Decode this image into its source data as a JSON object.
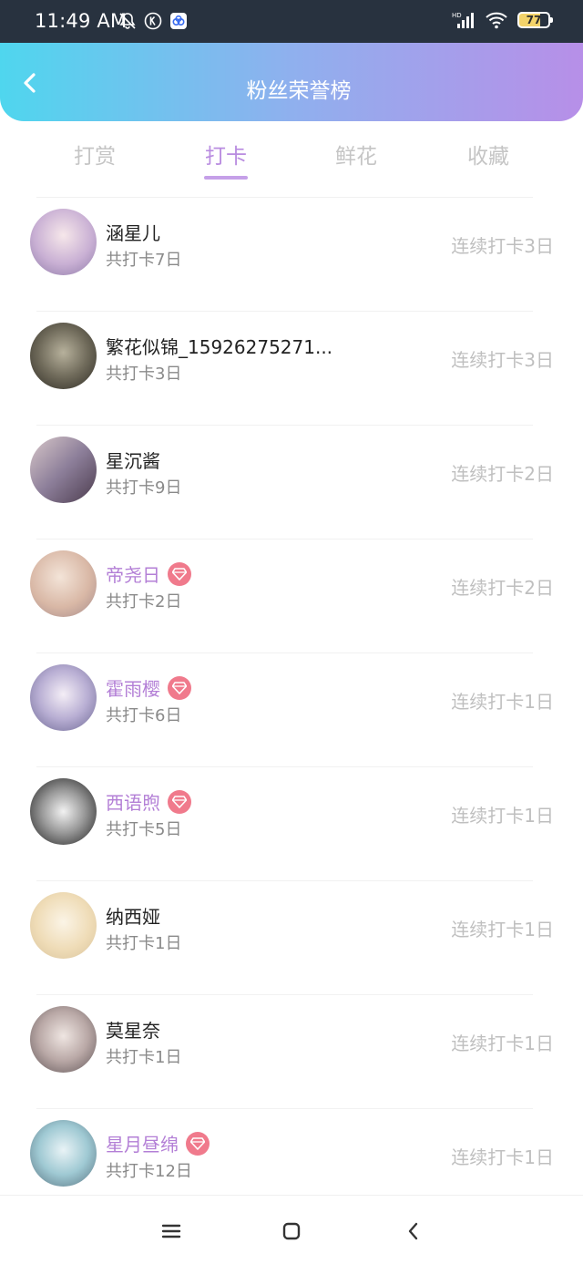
{
  "status_bar": {
    "time": "11:49 AM",
    "icons": [
      "mute-bell-icon",
      "k-app-icon",
      "cloud-app-icon"
    ],
    "battery": "77",
    "network": "HD"
  },
  "header": {
    "title": "粉丝荣誉榜",
    "back_icon": "back-chevron-icon"
  },
  "tabs": [
    {
      "label": "打赏",
      "active": false
    },
    {
      "label": "打卡",
      "active": true
    },
    {
      "label": "鲜花",
      "active": false
    },
    {
      "label": "收藏",
      "active": false
    }
  ],
  "colors": {
    "accent": "#b98ce0",
    "vip_name": "#b37fd6",
    "vip_badge": "#f07a8c",
    "header_gradient": [
      "#4fd6ee",
      "#b78fe8"
    ]
  },
  "fans": [
    {
      "name": "涵星儿",
      "vip": false,
      "total": "共打卡7日",
      "streak": "连续打卡3日"
    },
    {
      "name": "繁花似锦_15926275271...",
      "vip": false,
      "total": "共打卡3日",
      "streak": "连续打卡3日"
    },
    {
      "name": "星沉酱",
      "vip": false,
      "total": "共打卡9日",
      "streak": "连续打卡2日"
    },
    {
      "name": "帝尧日",
      "vip": true,
      "total": "共打卡2日",
      "streak": "连续打卡2日"
    },
    {
      "name": "霍雨樱",
      "vip": true,
      "total": "共打卡6日",
      "streak": "连续打卡1日"
    },
    {
      "name": "西语煦",
      "vip": true,
      "total": "共打卡5日",
      "streak": "连续打卡1日"
    },
    {
      "name": "纳西娅",
      "vip": false,
      "total": "共打卡1日",
      "streak": "连续打卡1日"
    },
    {
      "name": "莫星奈",
      "vip": false,
      "total": "共打卡1日",
      "streak": "连续打卡1日"
    },
    {
      "name": "星月昼绵",
      "vip": true,
      "total": "共打卡12日",
      "streak": "连续打卡1日"
    }
  ],
  "nav": [
    "menu-icon",
    "home-square-icon",
    "back-icon"
  ]
}
